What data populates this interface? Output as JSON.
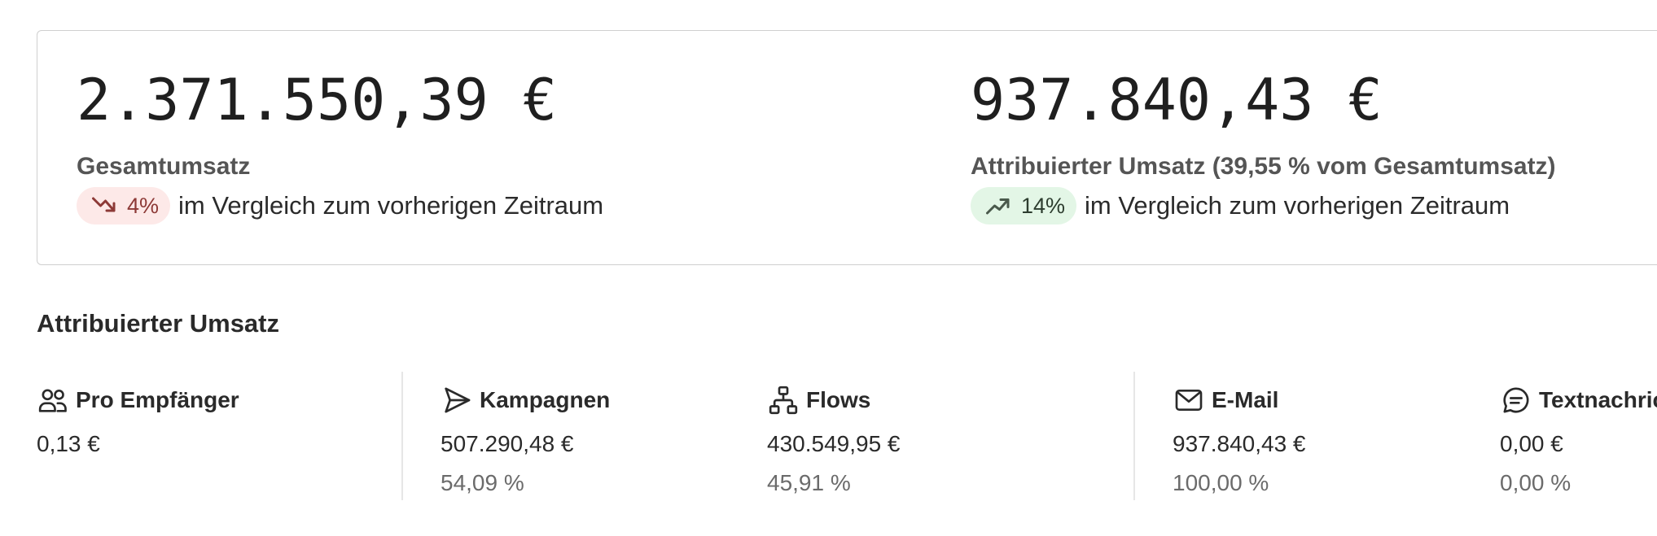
{
  "summary": {
    "total_revenue": {
      "value": "2.371.550,39 €",
      "label": "Gesamtumsatz",
      "trend": {
        "direction": "down",
        "icon": "trend-down-icon",
        "value": "4%",
        "color": "#8d3a37",
        "background": "#fde9e8"
      },
      "comparison_text": "im Vergleich zum vorherigen Zeitraum"
    },
    "attributed_revenue": {
      "value": "937.840,43 €",
      "label": "Attribuierter Umsatz (39,55 % vom Gesamtumsatz)",
      "trend": {
        "direction": "up",
        "icon": "trend-up-icon",
        "value": "14%",
        "color": "#2d3d2f",
        "background": "#e3f6e6"
      },
      "comparison_text": "im Vergleich zum vorherigen Zeitraum"
    }
  },
  "attributed_section": {
    "title": "Attribuierter Umsatz",
    "stats": [
      {
        "icon": "users-icon",
        "title": "Pro Empfänger",
        "value": "0,13 €",
        "percent": ""
      },
      {
        "icon": "send-icon",
        "title": "Kampagnen",
        "value": "507.290,48 €",
        "percent": "54,09 %"
      },
      {
        "icon": "flows-icon",
        "title": "Flows",
        "value": "430.549,95 €",
        "percent": "45,91 %"
      },
      {
        "icon": "mail-icon",
        "title": "E-Mail",
        "value": "937.840,43 €",
        "percent": "100,00 %"
      },
      {
        "icon": "message-icon",
        "title": "Textnachrichten",
        "value": "0,00 €",
        "percent": "0,00 %"
      }
    ]
  }
}
